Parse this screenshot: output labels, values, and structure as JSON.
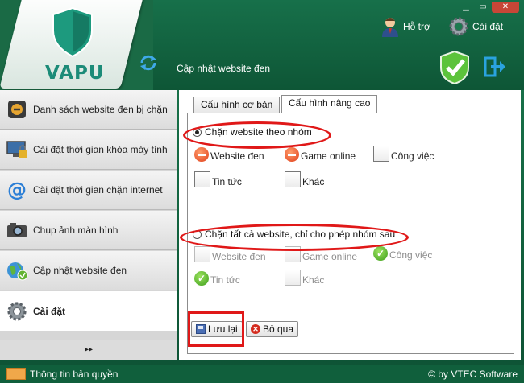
{
  "window": {
    "minimize": "▁",
    "restore": "▭",
    "close": "✕"
  },
  "logo": {
    "text": "VAPU"
  },
  "header": {
    "support_label": "Hỗ trợ",
    "settings_label": "Cài đặt",
    "page_title": "Cập nhật website đen"
  },
  "sidebar": {
    "items": [
      {
        "label": "Danh sách website đen bị chặn",
        "icon": "blocked-list-icon"
      },
      {
        "label": "Cài đặt thời gian khóa máy tính",
        "icon": "computer-lock-icon"
      },
      {
        "label": "Cài đặt thời gian chặn internet",
        "icon": "internet-icon"
      },
      {
        "label": "Chụp ảnh màn hình",
        "icon": "camera-icon"
      },
      {
        "label": "Cập nhật website đen",
        "icon": "globe-update-icon"
      },
      {
        "label": "Cài đặt",
        "icon": "gear-icon"
      }
    ],
    "more": "▸▸"
  },
  "tabs": [
    {
      "label": "Cấu hình cơ bản"
    },
    {
      "label": "Cấu hình nâng cao"
    }
  ],
  "group_mode": {
    "label": "Chặn website theo nhóm",
    "selected": true,
    "options": [
      {
        "label": "Website đen",
        "state": "blocked"
      },
      {
        "label": "Game online",
        "state": "blocked"
      },
      {
        "label": "Công việc",
        "state": "unchecked"
      },
      {
        "label": "Tin tức",
        "state": "unchecked"
      },
      {
        "label": "Khác",
        "state": "unchecked"
      }
    ]
  },
  "allow_mode": {
    "label": "Chặn tất cả website, chỉ cho phép nhóm sau",
    "selected": false,
    "options": [
      {
        "label": "Website đen",
        "state": "unchecked"
      },
      {
        "label": "Game online",
        "state": "unchecked"
      },
      {
        "label": "Công việc",
        "state": "allowed"
      },
      {
        "label": "Tin tức",
        "state": "allowed"
      },
      {
        "label": "Khác",
        "state": "unchecked"
      }
    ]
  },
  "buttons": {
    "save": "Lưu lại",
    "cancel": "Bỏ qua"
  },
  "statusbar": {
    "license": "Thông tin bản quyền",
    "copyright": "© by VTEC Software"
  },
  "colors": {
    "brand_green": "#0f5e3c",
    "highlight_red": "#e01818"
  }
}
